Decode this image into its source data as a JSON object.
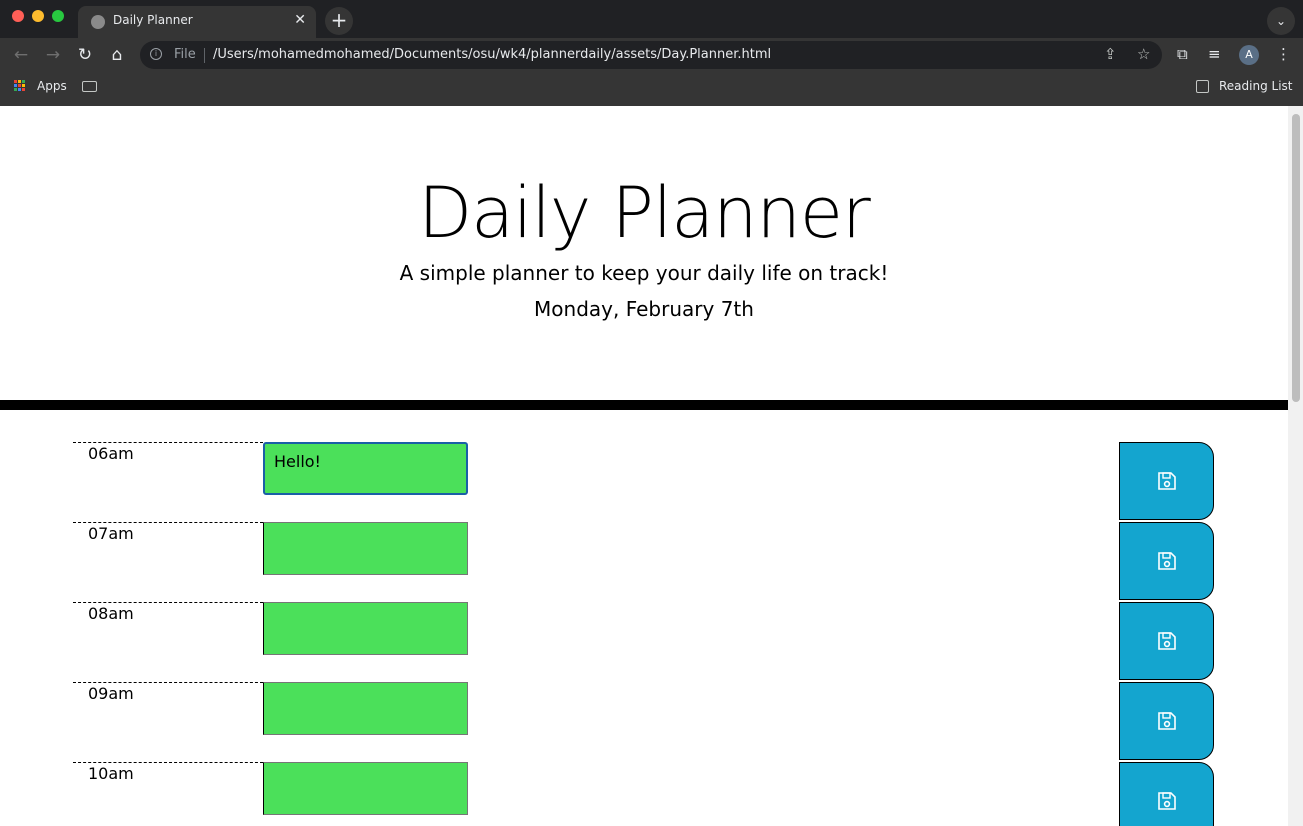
{
  "browser": {
    "tab_title": "Daily Planner",
    "omnibox_scheme": "File",
    "url": "/Users/mohamedmohamed/Documents/osu/wk4/plannerdaily/assets/Day.Planner.html",
    "bookmarks": {
      "apps_label": "Apps",
      "reading_list_label": "Reading List"
    },
    "profile_initial": "A"
  },
  "header": {
    "title": "Daily Planner",
    "lead": "A simple planner to keep your daily life on track!",
    "current_day": "Monday, February 7th"
  },
  "rows": [
    {
      "hour": "06am",
      "value": "Hello!"
    },
    {
      "hour": "07am",
      "value": ""
    },
    {
      "hour": "08am",
      "value": ""
    },
    {
      "hour": "09am",
      "value": ""
    },
    {
      "hour": "10am",
      "value": ""
    }
  ],
  "colors": {
    "future": "#4be05a",
    "save_button": "#14a5cf"
  }
}
